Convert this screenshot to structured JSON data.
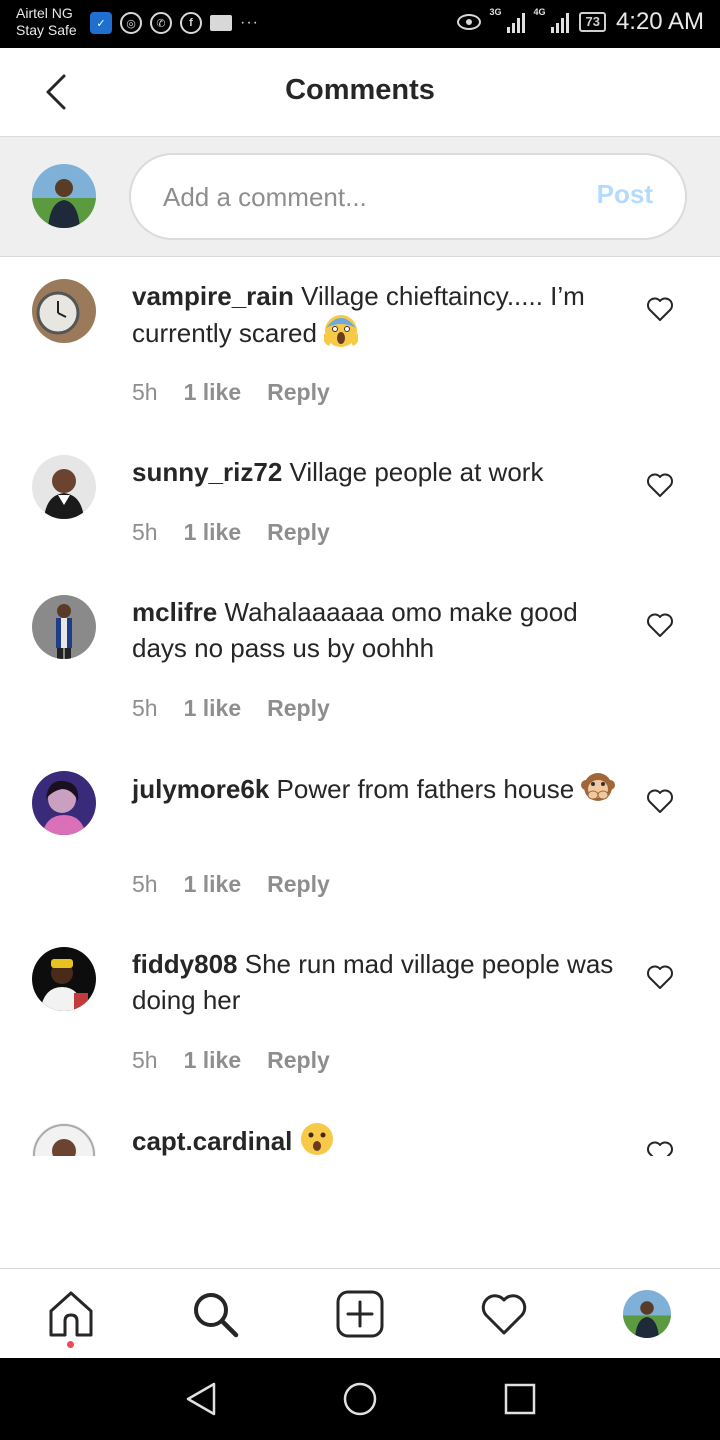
{
  "status_bar": {
    "carrier_line1": "Airtel NG",
    "carrier_line2": "Stay Safe",
    "network1": "3G",
    "network2": "4G",
    "battery": "73",
    "time": "4:20 AM"
  },
  "header": {
    "title": "Comments",
    "back_icon": "chevron-left-icon"
  },
  "composer": {
    "placeholder": "Add a comment...",
    "post_label": "Post",
    "post_color": "#b3dbff"
  },
  "comments": [
    {
      "username": "vampire_rain",
      "text": "Village chieftaincy..... I’m currently scared",
      "emoji": "screaming-face",
      "time": "5h",
      "likes": "1 like",
      "reply": "Reply"
    },
    {
      "username": "sunny_riz72",
      "text": "Village people at work",
      "time": "5h",
      "likes": "1 like",
      "reply": "Reply"
    },
    {
      "username": "mclifre",
      "text": "Wahalaaaaaa omo make good days no pass us by oohhh",
      "time": "5h",
      "likes": "1 like",
      "reply": "Reply"
    },
    {
      "username": "julymore6k",
      "text": "Power from fathers house",
      "emoji": "speak-no-evil-monkey",
      "time": "5h",
      "likes": "1 like",
      "reply": "Reply"
    },
    {
      "username": "fiddy808",
      "text": "She run mad village people was doing her",
      "time": "5h",
      "likes": "1 like",
      "reply": "Reply"
    },
    {
      "username": "capt.cardinal",
      "text": "",
      "emoji": "astonished-face"
    }
  ],
  "bottom_nav": {
    "items": [
      "home-icon",
      "search-icon",
      "new-post-icon",
      "activity-heart-icon",
      "profile-avatar"
    ],
    "notification_dot_color": "#ed4956"
  },
  "system_nav": [
    "back-triangle-icon",
    "home-circle-icon",
    "recents-square-icon"
  ]
}
